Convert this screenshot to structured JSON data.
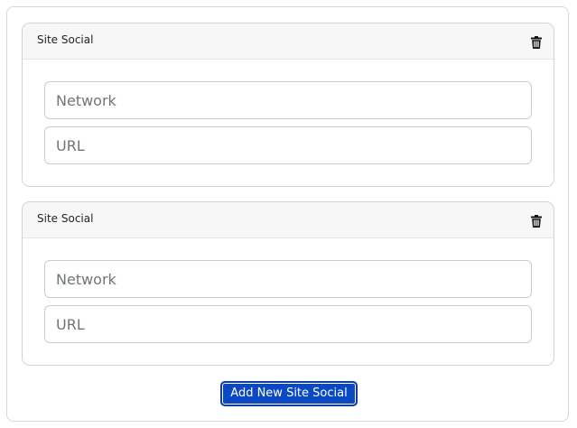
{
  "cards": [
    {
      "title": "Site Social",
      "network_placeholder": "Network",
      "url_placeholder": "URL",
      "delete_icon": "trash-icon"
    },
    {
      "title": "Site Social",
      "network_placeholder": "Network",
      "url_placeholder": "URL",
      "delete_icon": "trash-icon"
    }
  ],
  "add_button_label": "Add New Site Social",
  "colors": {
    "accent": "#0b49c4",
    "header_bg": "#f7f7f8",
    "border": "#cfd2d6"
  }
}
